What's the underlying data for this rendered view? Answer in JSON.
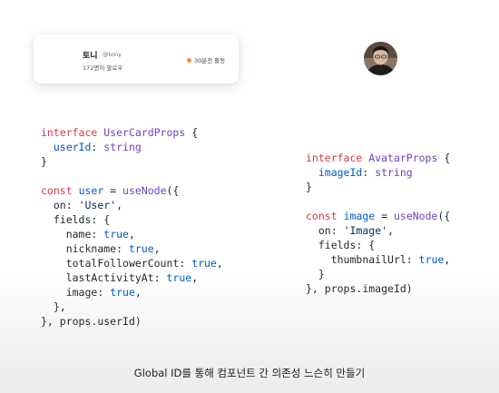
{
  "user_card": {
    "name": "토니",
    "handle": "@tony",
    "followers": "172명이 팔로우",
    "status": "30분전 활동",
    "status_color": "#f0952b"
  },
  "avatar": {
    "icon": "person-photo-avatar",
    "background_color": "#6e5a4e"
  },
  "code_left": {
    "interface_keyword": "interface",
    "interface_name": "UserCardProps",
    "prop_name": "userId",
    "prop_type": "string",
    "const_keyword": "const",
    "var_name": "user",
    "hook_name": "useNode",
    "on_key": "on",
    "on_value": "'User'",
    "fields_key": "fields",
    "fields": [
      {
        "key": "name",
        "value": "true"
      },
      {
        "key": "nickname",
        "value": "true"
      },
      {
        "key": "totalFollowerCount",
        "value": "true"
      },
      {
        "key": "lastActivityAt",
        "value": "true"
      },
      {
        "key": "image",
        "value": "true"
      }
    ],
    "id_arg": "props.userId"
  },
  "code_right": {
    "interface_keyword": "interface",
    "interface_name": "AvatarProps",
    "prop_name": "imageId",
    "prop_type": "string",
    "const_keyword": "const",
    "var_name": "image",
    "hook_name": "useNode",
    "on_key": "on",
    "on_value": "'Image'",
    "fields_key": "fields",
    "fields": [
      {
        "key": "thumbnailUrl",
        "value": "true"
      }
    ],
    "id_arg": "props.imageId"
  },
  "caption": "Global ID를 통해 컴포넌트 간 의존성 느슨히 만들기",
  "colors": {
    "keyword": "#d73a49",
    "type": "#6f42c1",
    "string": "#032f62",
    "property": "#005cc5",
    "text": "#24292e"
  }
}
